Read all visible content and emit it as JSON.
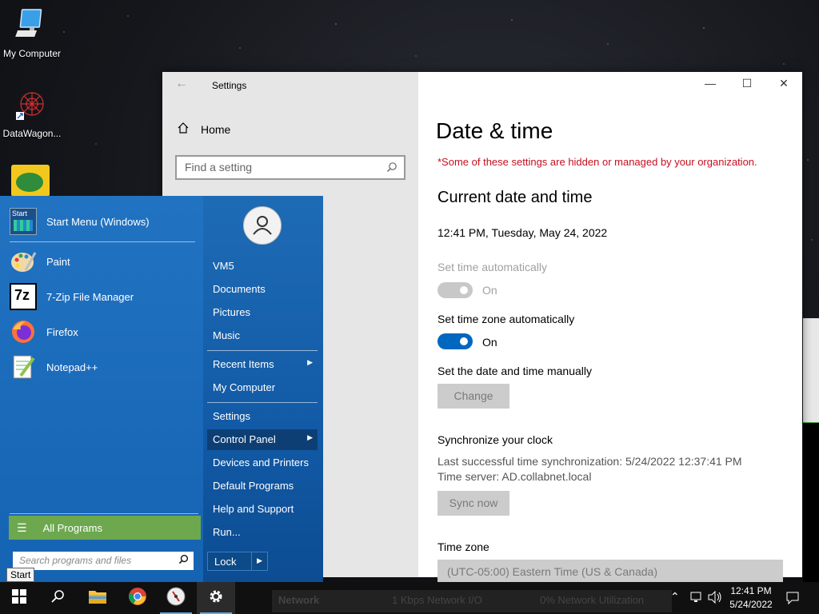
{
  "desktop": {
    "icons": [
      {
        "label": "My Computer",
        "icon": "computer-icon"
      },
      {
        "label": "DataWagon...",
        "icon": "datawagon-icon"
      }
    ]
  },
  "settings": {
    "window_title": "Settings",
    "home_label": "Home",
    "search_placeholder": "Find a setting",
    "page_title": "Date & time",
    "org_warning": "*Some of these settings are hidden or managed by your organization.",
    "section_current": "Current date and time",
    "current_datetime": "12:41 PM, Tuesday, May 24, 2022",
    "set_time_auto_label": "Set time automatically",
    "set_time_auto_state": "On",
    "set_tz_auto_label": "Set time zone automatically",
    "set_tz_auto_state": "On",
    "manual_label": "Set the date and time manually",
    "change_button": "Change",
    "sync_heading": "Synchronize your clock",
    "last_sync": "Last successful time synchronization: 5/24/2022 12:37:41 PM",
    "time_server": "Time server: AD.collabnet.local",
    "sync_button": "Sync now",
    "timezone_label": "Time zone",
    "timezone_value": "(UTC-05:00) Eastern Time (US & Canada)",
    "accent_color": "#0067c0"
  },
  "start_menu": {
    "pinned": [
      {
        "label": "Start Menu (Windows)",
        "icon": "start-menu-icon"
      },
      {
        "label": "Paint",
        "icon": "paint-icon"
      },
      {
        "label": "7-Zip File Manager",
        "icon": "7zip-icon"
      },
      {
        "label": "Firefox",
        "icon": "firefox-icon"
      },
      {
        "label": "Notepad++",
        "icon": "notepadpp-icon"
      }
    ],
    "right_items": [
      {
        "label": "VM5"
      },
      {
        "label": "Documents"
      },
      {
        "label": "Pictures"
      },
      {
        "label": "Music"
      },
      {
        "label": "Recent Items"
      },
      {
        "label": "My Computer"
      },
      {
        "label": "Settings"
      },
      {
        "label": "Control Panel"
      },
      {
        "label": "Devices and Printers"
      },
      {
        "label": "Default Programs"
      },
      {
        "label": "Help and Support"
      },
      {
        "label": "Run..."
      }
    ],
    "all_programs": "All Programs",
    "search_placeholder": "Search programs and files",
    "lock_label": "Lock",
    "start_tooltip": "Start",
    "icon_7z_text": "7z",
    "icon_start_text": "Start"
  },
  "taskbar": {
    "clock_time": "12:41 PM",
    "clock_date": "5/24/2022",
    "bg_app_title": "Network",
    "bg_app_items": [
      "1 Kbps Network I/O",
      "0% Network Utilization"
    ]
  }
}
